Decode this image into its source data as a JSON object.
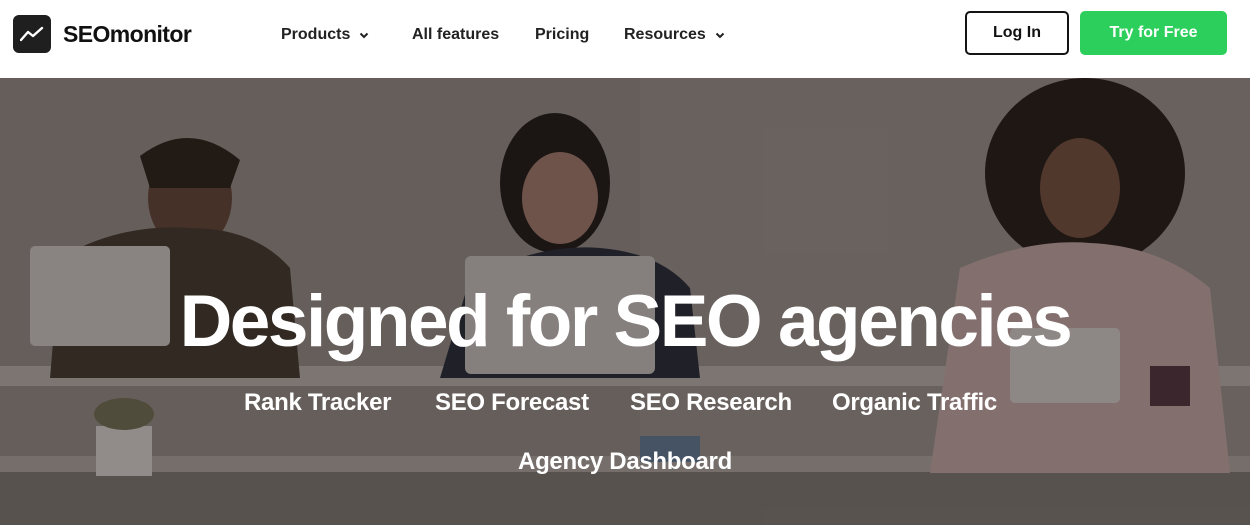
{
  "brand": {
    "name": "SEOmonitor",
    "icon": "trend-line-icon"
  },
  "nav": {
    "products": "Products",
    "all_features": "All features",
    "pricing": "Pricing",
    "resources": "Resources"
  },
  "actions": {
    "login": "Log In",
    "try_free": "Try for Free"
  },
  "hero": {
    "title": "Designed for SEO agencies",
    "links": [
      "Rank Tracker",
      "SEO Forecast",
      "SEO Research",
      "Organic Traffic",
      "Agency Dashboard"
    ]
  },
  "colors": {
    "cta_green": "#2ccf5b",
    "dark": "#1f1f1f",
    "hero_text": "#ffffff"
  }
}
